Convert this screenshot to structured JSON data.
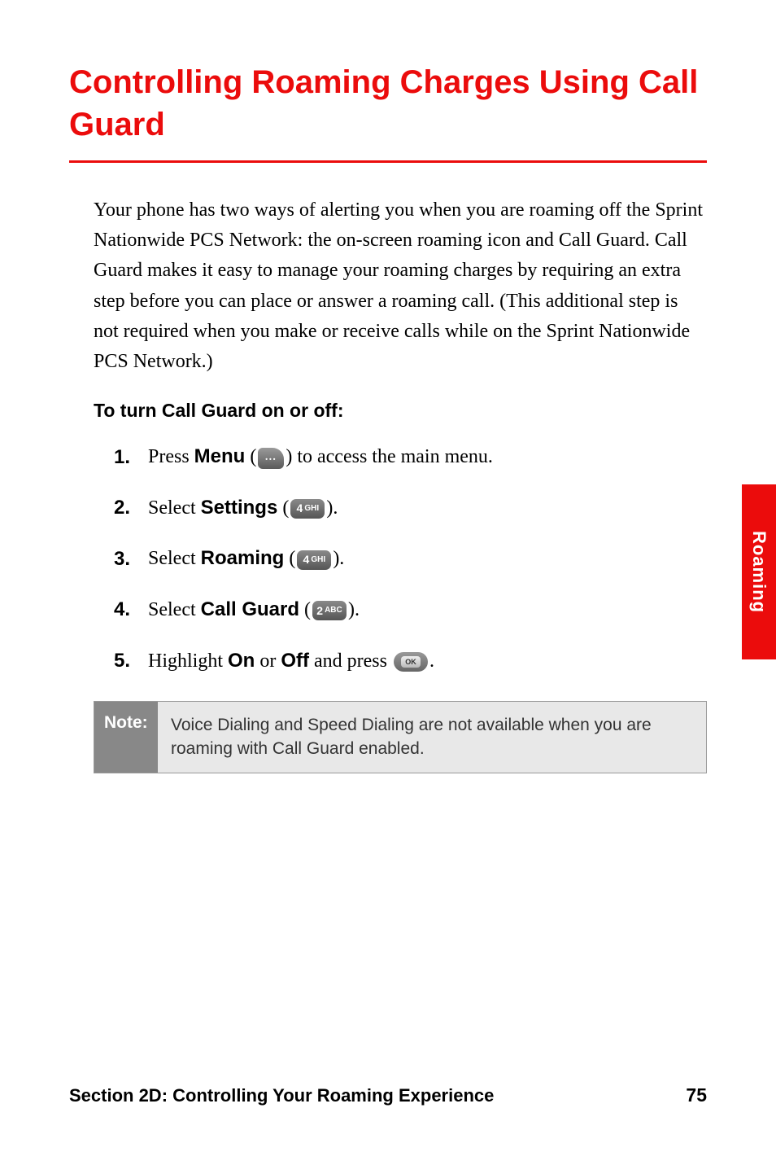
{
  "title": "Controlling Roaming Charges Using Call Guard",
  "intro": "Your phone has two ways of alerting you when you are roaming off the Sprint Nationwide PCS Network: the on-screen roaming icon and Call Guard. Call Guard makes it easy to manage your roaming charges by requiring an extra step before you can place or answer a roaming call. (This additional step is not required when you make or receive calls while on the Sprint Nationwide PCS Network.)",
  "subheading": "To turn Call Guard on or off:",
  "steps": [
    {
      "num": "1.",
      "pre": "Press ",
      "bold": "Menu",
      "post1": " (",
      "icon": "menu-key",
      "post2": ") to access the main menu."
    },
    {
      "num": "2.",
      "pre": "Select ",
      "bold": "Settings",
      "post1": " (",
      "icon": "4-ghi-key",
      "post2": ")."
    },
    {
      "num": "3.",
      "pre": "Select ",
      "bold": "Roaming",
      "post1": " (",
      "icon": "4-ghi-key",
      "post2": ")."
    },
    {
      "num": "4.",
      "pre": "Select ",
      "bold": "Call Guard",
      "post1": " (",
      "icon": "2-abc-key",
      "post2": ")."
    },
    {
      "num": "5.",
      "pre": "Highlight ",
      "bold": "On",
      "mid": " or ",
      "bold2": "Off",
      "post1": " and press ",
      "icon": "ok-key",
      "post2": "."
    }
  ],
  "keyLabels": {
    "key4_num": "4",
    "key4_letters": "GHI",
    "key2_num": "2",
    "key2_letters": "ABC",
    "ok": "OK"
  },
  "note": {
    "label": "Note:",
    "text": "Voice Dialing and Speed Dialing are not available when you are roaming with Call Guard enabled."
  },
  "sideTab": "Roaming",
  "footer": {
    "section": "Section 2D: Controlling Your Roaming Experience",
    "page": "75"
  }
}
